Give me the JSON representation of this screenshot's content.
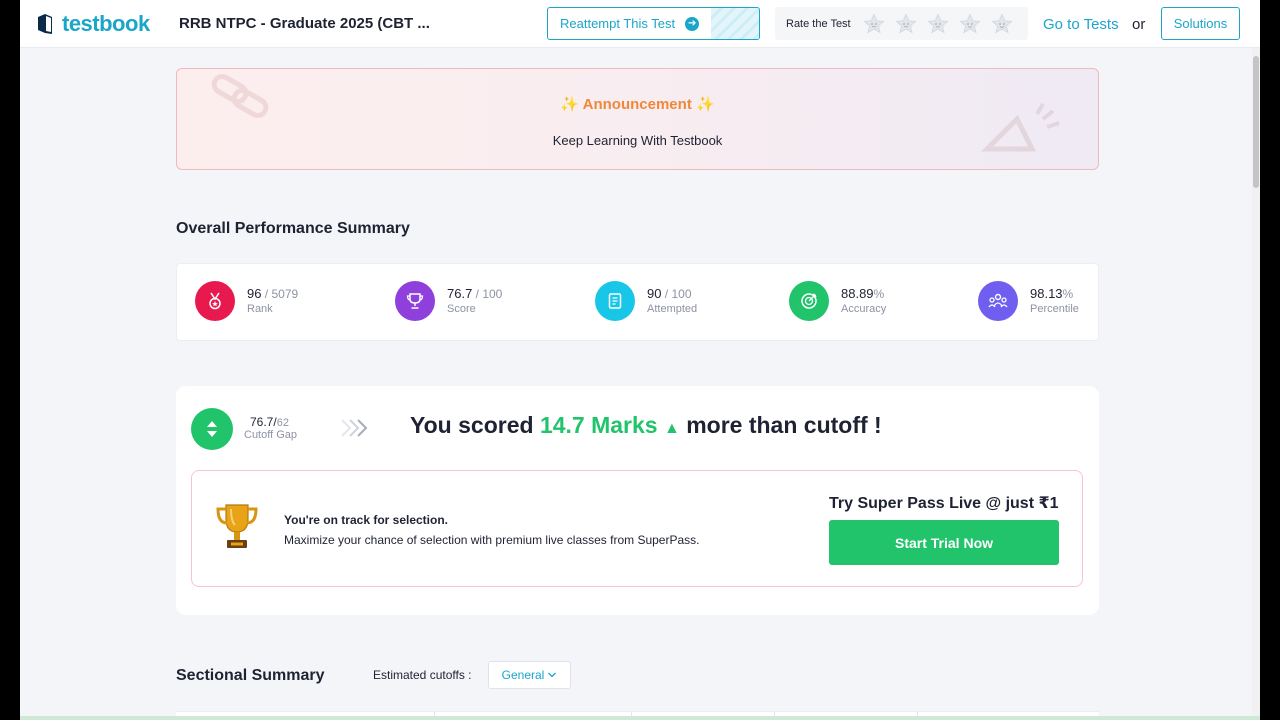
{
  "header": {
    "logo_text": "testbook",
    "test_title": "RRB NTPC - Graduate 2025 (CBT ...",
    "reattempt_label": "Reattempt This Test",
    "rate_label": "Rate the Test",
    "rating_icons": [
      "star-icon",
      "star-icon",
      "star-icon",
      "star-icon",
      "star-icon"
    ],
    "goto_tests_label": "Go to Tests",
    "or_label": "or",
    "solutions_label": "Solutions",
    "accent_color": "#1aa6c9"
  },
  "announcement": {
    "title": "Announcement",
    "text": "Keep Learning With Testbook",
    "title_color": "#f0883a"
  },
  "performance": {
    "section_title": "Overall Performance Summary",
    "stats": [
      {
        "value": "96",
        "of": " / 5079",
        "label": "Rank",
        "icon": "medal-icon",
        "color": "#e8194f"
      },
      {
        "value": "76.7",
        "of": " / 100",
        "label": "Score",
        "icon": "trophy-icon",
        "color": "#8e3fdc"
      },
      {
        "value": "90",
        "of": " / 100",
        "label": "Attempted",
        "icon": "clipboard-icon",
        "color": "#18c7e8"
      },
      {
        "value": "88.89",
        "of": "%",
        "label": "Accuracy",
        "icon": "target-icon",
        "color": "#21c46b"
      },
      {
        "value": "98.13",
        "of": "%",
        "label": "Percentile",
        "icon": "people-icon",
        "color": "#6f5ef0"
      }
    ]
  },
  "cutoff": {
    "value": "76.7/",
    "of": "62",
    "label": "Cutoff Gap",
    "scored_prefix": "You scored ",
    "scored_marks": "14.7 Marks",
    "scored_arrow": "▲",
    "scored_suffix": " more than cutoff !",
    "green": "#21c46b"
  },
  "promo": {
    "bold_text": "You're on track for selection.",
    "text": "Maximize your chance of selection with premium live classes from SuperPass.",
    "superpass_title": "Try Super Pass Live @ just ₹1",
    "trial_button": "Start Trial Now"
  },
  "sectional": {
    "title": "Sectional Summary",
    "est_label": "Estimated cutoffs :",
    "selected_category": "General"
  }
}
